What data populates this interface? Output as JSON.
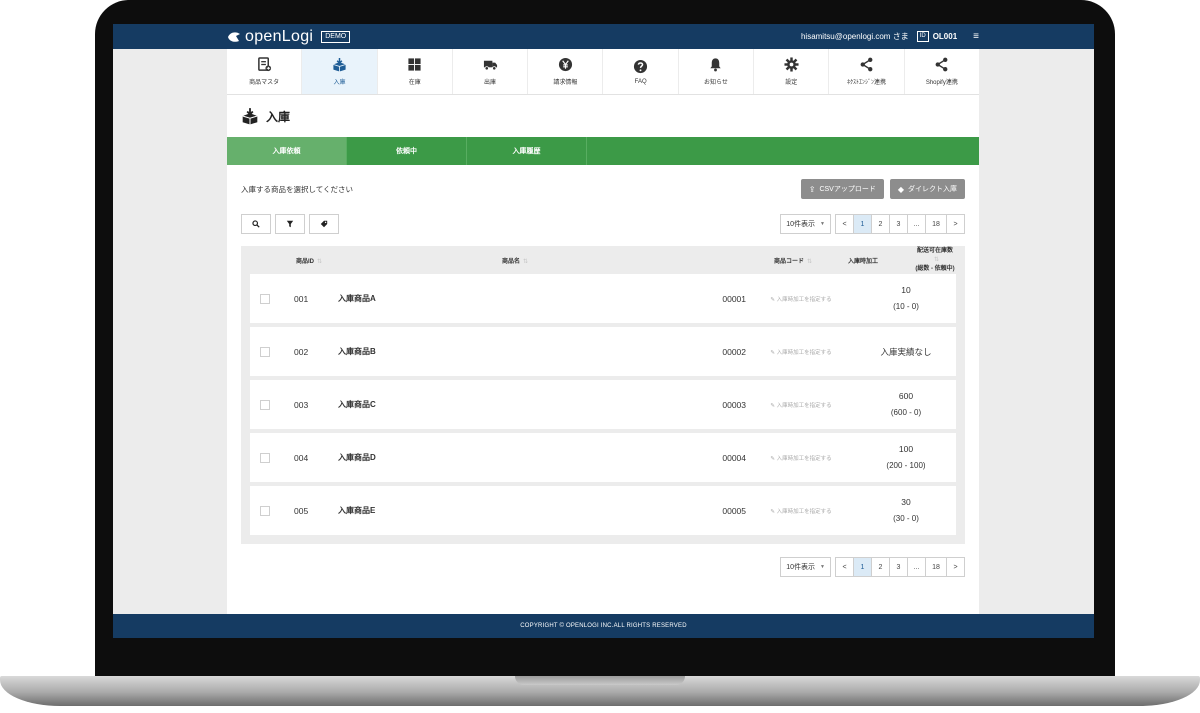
{
  "header": {
    "logo_text": "openLogi",
    "demo_badge": "DEMO",
    "user_email": "hisamitsu@openlogi.com さま",
    "id_badge": "ID",
    "account_id": "OL001"
  },
  "nav": {
    "items": [
      {
        "label": "商品マスタ",
        "icon": "product-master-icon"
      },
      {
        "label": "入庫",
        "icon": "inbound-box-icon"
      },
      {
        "label": "在庫",
        "icon": "stock-icon"
      },
      {
        "label": "出庫",
        "icon": "truck-icon"
      },
      {
        "label": "請求情報",
        "icon": "yen-coin-icon"
      },
      {
        "label": "FAQ",
        "icon": "question-icon"
      },
      {
        "label": "お知らせ",
        "icon": "bell-icon"
      },
      {
        "label": "設定",
        "icon": "gear-icon"
      },
      {
        "label": "ﾈｸｽﾄｴﾝｼﾞﾝ連携",
        "icon": "share-icon"
      },
      {
        "label": "Shopify連携",
        "icon": "share-icon"
      }
    ],
    "active_index": 1
  },
  "page": {
    "title": "入庫",
    "tabs": [
      "入庫依頼",
      "依頼中",
      "入庫履歴"
    ],
    "active_tab": 0,
    "instruction": "入庫する商品を選択してください",
    "csv_button": "CSVアップロード",
    "direct_button": "ダイレクト入庫"
  },
  "pagination": {
    "per_page": "10件表示",
    "prev": "<",
    "pages": [
      "1",
      "2",
      "3",
      "...",
      "18"
    ],
    "next": ">",
    "current": "1"
  },
  "table": {
    "headers": {
      "id": "商品ID",
      "name": "商品名",
      "code": "商品コード",
      "processing": "入庫時加工",
      "stock_line1": "配送可在庫数",
      "stock_line2": "(総数 - 依頼中)"
    },
    "rows": [
      {
        "id": "001",
        "name": "入庫商品A",
        "code": "00001",
        "processing": "入庫時加工を指定する",
        "stock": "10",
        "stock_detail": "(10 - 0)"
      },
      {
        "id": "002",
        "name": "入庫商品B",
        "code": "00002",
        "processing": "入庫時加工を指定する",
        "stock": "入庫実績なし",
        "stock_detail": ""
      },
      {
        "id": "003",
        "name": "入庫商品C",
        "code": "00003",
        "processing": "入庫時加工を指定する",
        "stock": "600",
        "stock_detail": "(600 - 0)"
      },
      {
        "id": "004",
        "name": "入庫商品D",
        "code": "00004",
        "processing": "入庫時加工を指定する",
        "stock": "100",
        "stock_detail": "(200 - 100)"
      },
      {
        "id": "005",
        "name": "入庫商品E",
        "code": "00005",
        "processing": "入庫時加工を指定する",
        "stock": "30",
        "stock_detail": "(30 - 0)"
      }
    ]
  },
  "footer": {
    "copyright": "COPYRIGHT © OPENLOGI INC.ALL RIGHTS RESERVED"
  },
  "colors": {
    "navy": "#153b62",
    "green": "#3c9a47",
    "active_tab": "#66b06c",
    "gray_button": "#8d8d8d"
  }
}
